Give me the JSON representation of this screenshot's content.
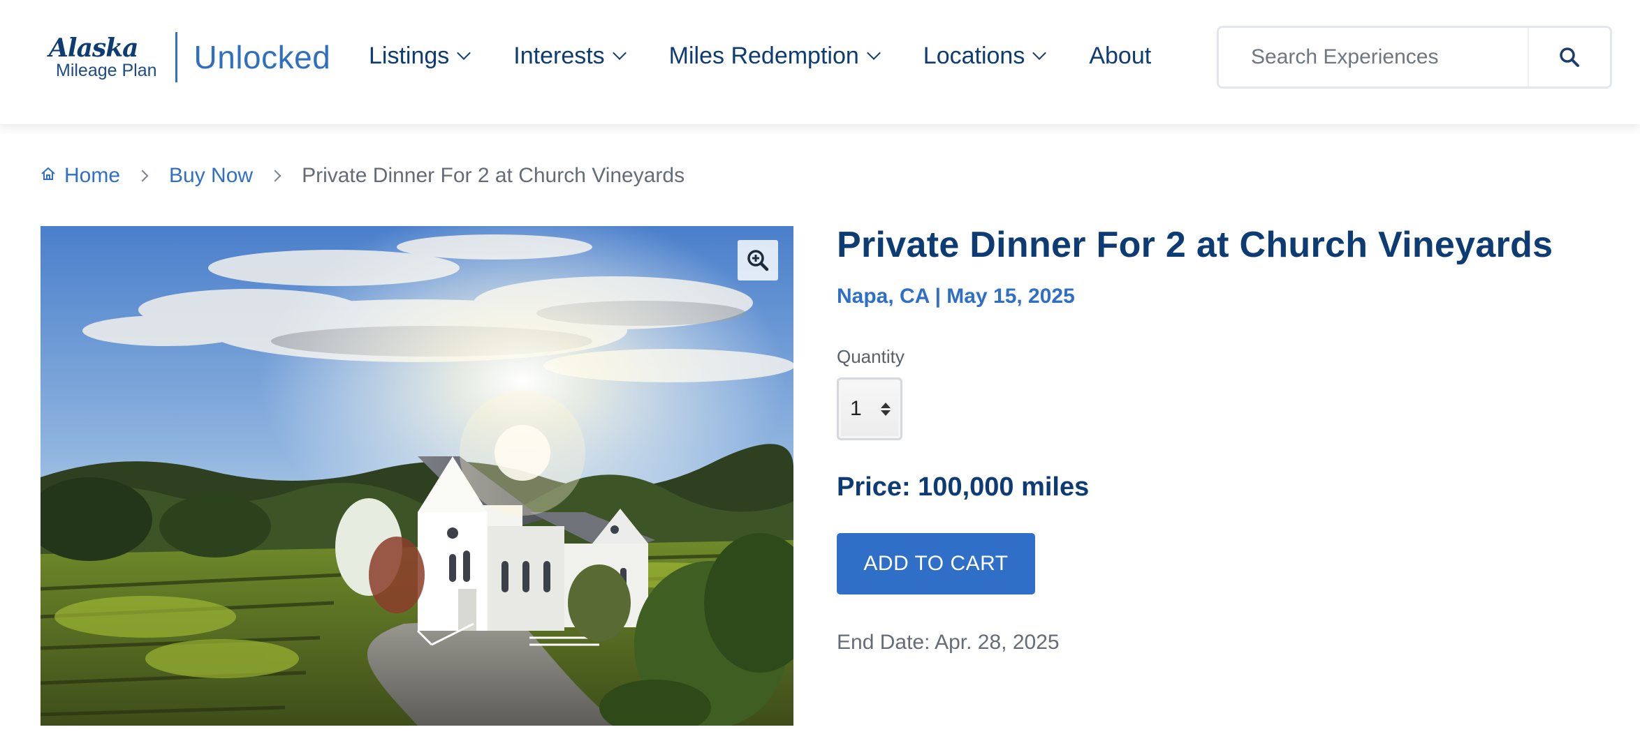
{
  "brand": {
    "airline": "Alaska",
    "program": "Mileage Plan",
    "product": "Unlocked"
  },
  "nav": {
    "items": [
      {
        "label": "Listings",
        "icon": "chevron-down-icon"
      },
      {
        "label": "Interests",
        "icon": "chevron-down-icon"
      },
      {
        "label": "Miles Redemption",
        "icon": "chevron-down-icon"
      },
      {
        "label": "Locations",
        "icon": "chevron-down-icon"
      },
      {
        "label": "About"
      }
    ]
  },
  "search": {
    "placeholder": "Search Experiences",
    "value": "",
    "icon": "search-icon"
  },
  "breadcrumb": {
    "home": "Home",
    "home_icon": "home-icon",
    "section": "Buy Now",
    "current": "Private Dinner For 2 at Church Vineyards"
  },
  "product": {
    "title": "Private Dinner For 2 at Church Vineyards",
    "subtitle": "Napa, CA | May 15, 2025",
    "quantity_label": "Quantity",
    "quantity_value": "1",
    "price": "Price: 100,000 miles",
    "add_to_cart": "ADD TO CART",
    "end_date": "End Date: Apr. 28, 2025",
    "zoom_icon": "zoom-in-icon"
  },
  "colors": {
    "navy": "#0d3b73",
    "accent_blue": "#2f6fc8",
    "muted_text": "#656c76"
  }
}
